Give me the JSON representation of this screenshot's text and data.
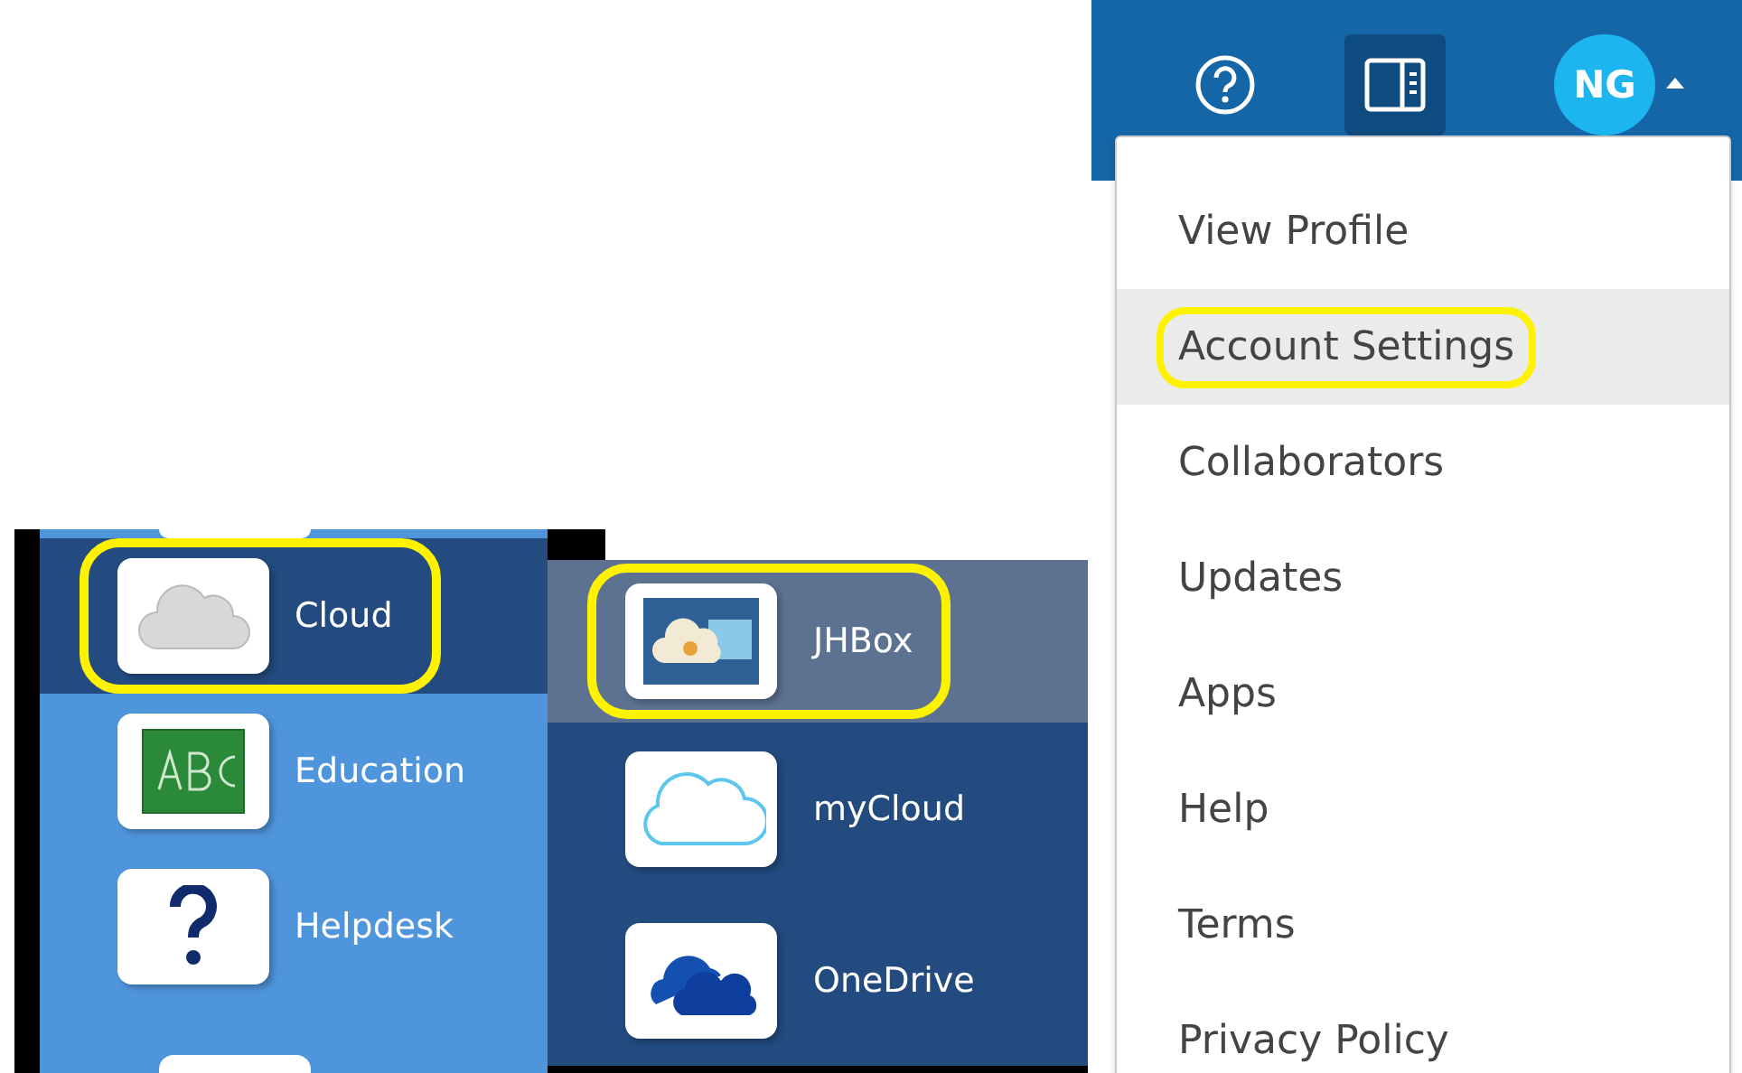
{
  "header": {
    "avatar": "NG"
  },
  "account_menu": {
    "items": [
      {
        "label": "View Profile",
        "selected": false,
        "annotated": false
      },
      {
        "label": "Account Settings",
        "selected": true,
        "annotated": true
      },
      {
        "label": "Collaborators",
        "selected": false,
        "annotated": false
      },
      {
        "label": "Updates",
        "selected": false,
        "annotated": false
      },
      {
        "label": "Apps",
        "selected": false,
        "annotated": false
      },
      {
        "label": "Help",
        "selected": false,
        "annotated": false
      },
      {
        "label": "Terms",
        "selected": false,
        "annotated": false
      },
      {
        "label": "Privacy Policy",
        "selected": false,
        "annotated": false
      }
    ]
  },
  "app_menu": {
    "categories": [
      {
        "label": "Cloud",
        "selected": true,
        "annotated": true
      },
      {
        "label": "Education",
        "selected": false,
        "annotated": false
      },
      {
        "label": "Helpdesk",
        "selected": false,
        "annotated": false
      }
    ],
    "submenu": [
      {
        "label": "JHBox",
        "selected": true,
        "annotated": true
      },
      {
        "label": "myCloud",
        "selected": false,
        "annotated": false
      },
      {
        "label": "OneDrive",
        "selected": false,
        "annotated": false
      }
    ]
  }
}
